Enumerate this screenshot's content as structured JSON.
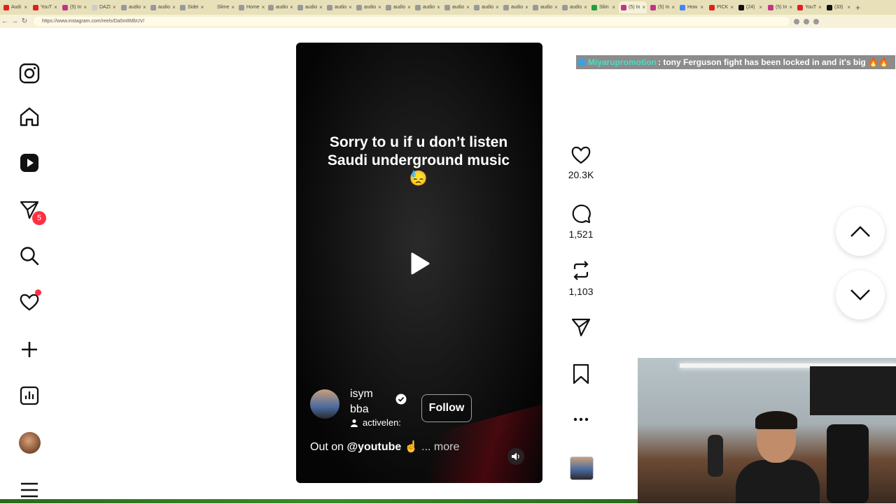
{
  "browser": {
    "url": "https://www.instagram.com/reels/Da5mlIMbUV/",
    "tabs": [
      {
        "label": "Audi",
        "color": "#e02020"
      },
      {
        "label": "YouT",
        "color": "#e02020"
      },
      {
        "label": "(5) In",
        "color": "#c13584"
      },
      {
        "label": "DAZI",
        "color": "#cccccc"
      },
      {
        "label": "audio",
        "color": "#999999"
      },
      {
        "label": "audio",
        "color": "#999999"
      },
      {
        "label": "Sidei",
        "color": "#999999"
      },
      {
        "label": "Slime",
        "color": "#e8e0b8"
      },
      {
        "label": "Home",
        "color": "#999999"
      },
      {
        "label": "audio",
        "color": "#999999"
      },
      {
        "label": "audio",
        "color": "#999999"
      },
      {
        "label": "audio",
        "color": "#999999"
      },
      {
        "label": "audio",
        "color": "#999999"
      },
      {
        "label": "audio",
        "color": "#999999"
      },
      {
        "label": "audio",
        "color": "#999999"
      },
      {
        "label": "audio",
        "color": "#999999"
      },
      {
        "label": "audio",
        "color": "#999999"
      },
      {
        "label": "audio",
        "color": "#999999"
      },
      {
        "label": "audio",
        "color": "#999999"
      },
      {
        "label": "audio",
        "color": "#999999"
      },
      {
        "label": "Slim",
        "color": "#20a040"
      },
      {
        "label": "(5) In",
        "color": "#c13584"
      },
      {
        "label": "(5) In",
        "color": "#c13584"
      },
      {
        "label": "How",
        "color": "#4285f4"
      },
      {
        "label": "PICK",
        "color": "#e02020"
      },
      {
        "label": "(24)",
        "color": "#111111"
      },
      {
        "label": "(5) In",
        "color": "#c13584"
      },
      {
        "label": "YouT",
        "color": "#e02020"
      },
      {
        "label": "(33)",
        "color": "#111111"
      }
    ]
  },
  "sidebar": {
    "items": [
      {
        "name": "instagram-logo-icon"
      },
      {
        "name": "home-icon"
      },
      {
        "name": "reels-icon"
      },
      {
        "name": "messages-icon",
        "badge": "5"
      },
      {
        "name": "search-icon"
      },
      {
        "name": "notifications-icon"
      },
      {
        "name": "create-icon"
      },
      {
        "name": "dashboard-icon"
      },
      {
        "name": "profile-avatar"
      },
      {
        "name": "more-menu-icon"
      }
    ]
  },
  "reel": {
    "caption": "Sorry to u if u don’t listen Saudi underground music 😓",
    "username": "isymbba",
    "audio": "activelen:",
    "follow_label": "Follow",
    "desc_prefix": "Out on",
    "desc_tag": "@youtube",
    "desc_emoji": "☝",
    "desc_more": "... more",
    "likes": "20.3K",
    "comments": "1,521",
    "reposts": "1,103"
  },
  "overlay_chat": {
    "user": "Miyarupromotion",
    "message": ": tony Ferguson fight has been locked in and it's big 🔥🔥"
  },
  "colors": {
    "accent_red": "#ff3040",
    "chat_user": "#45e0c0"
  }
}
